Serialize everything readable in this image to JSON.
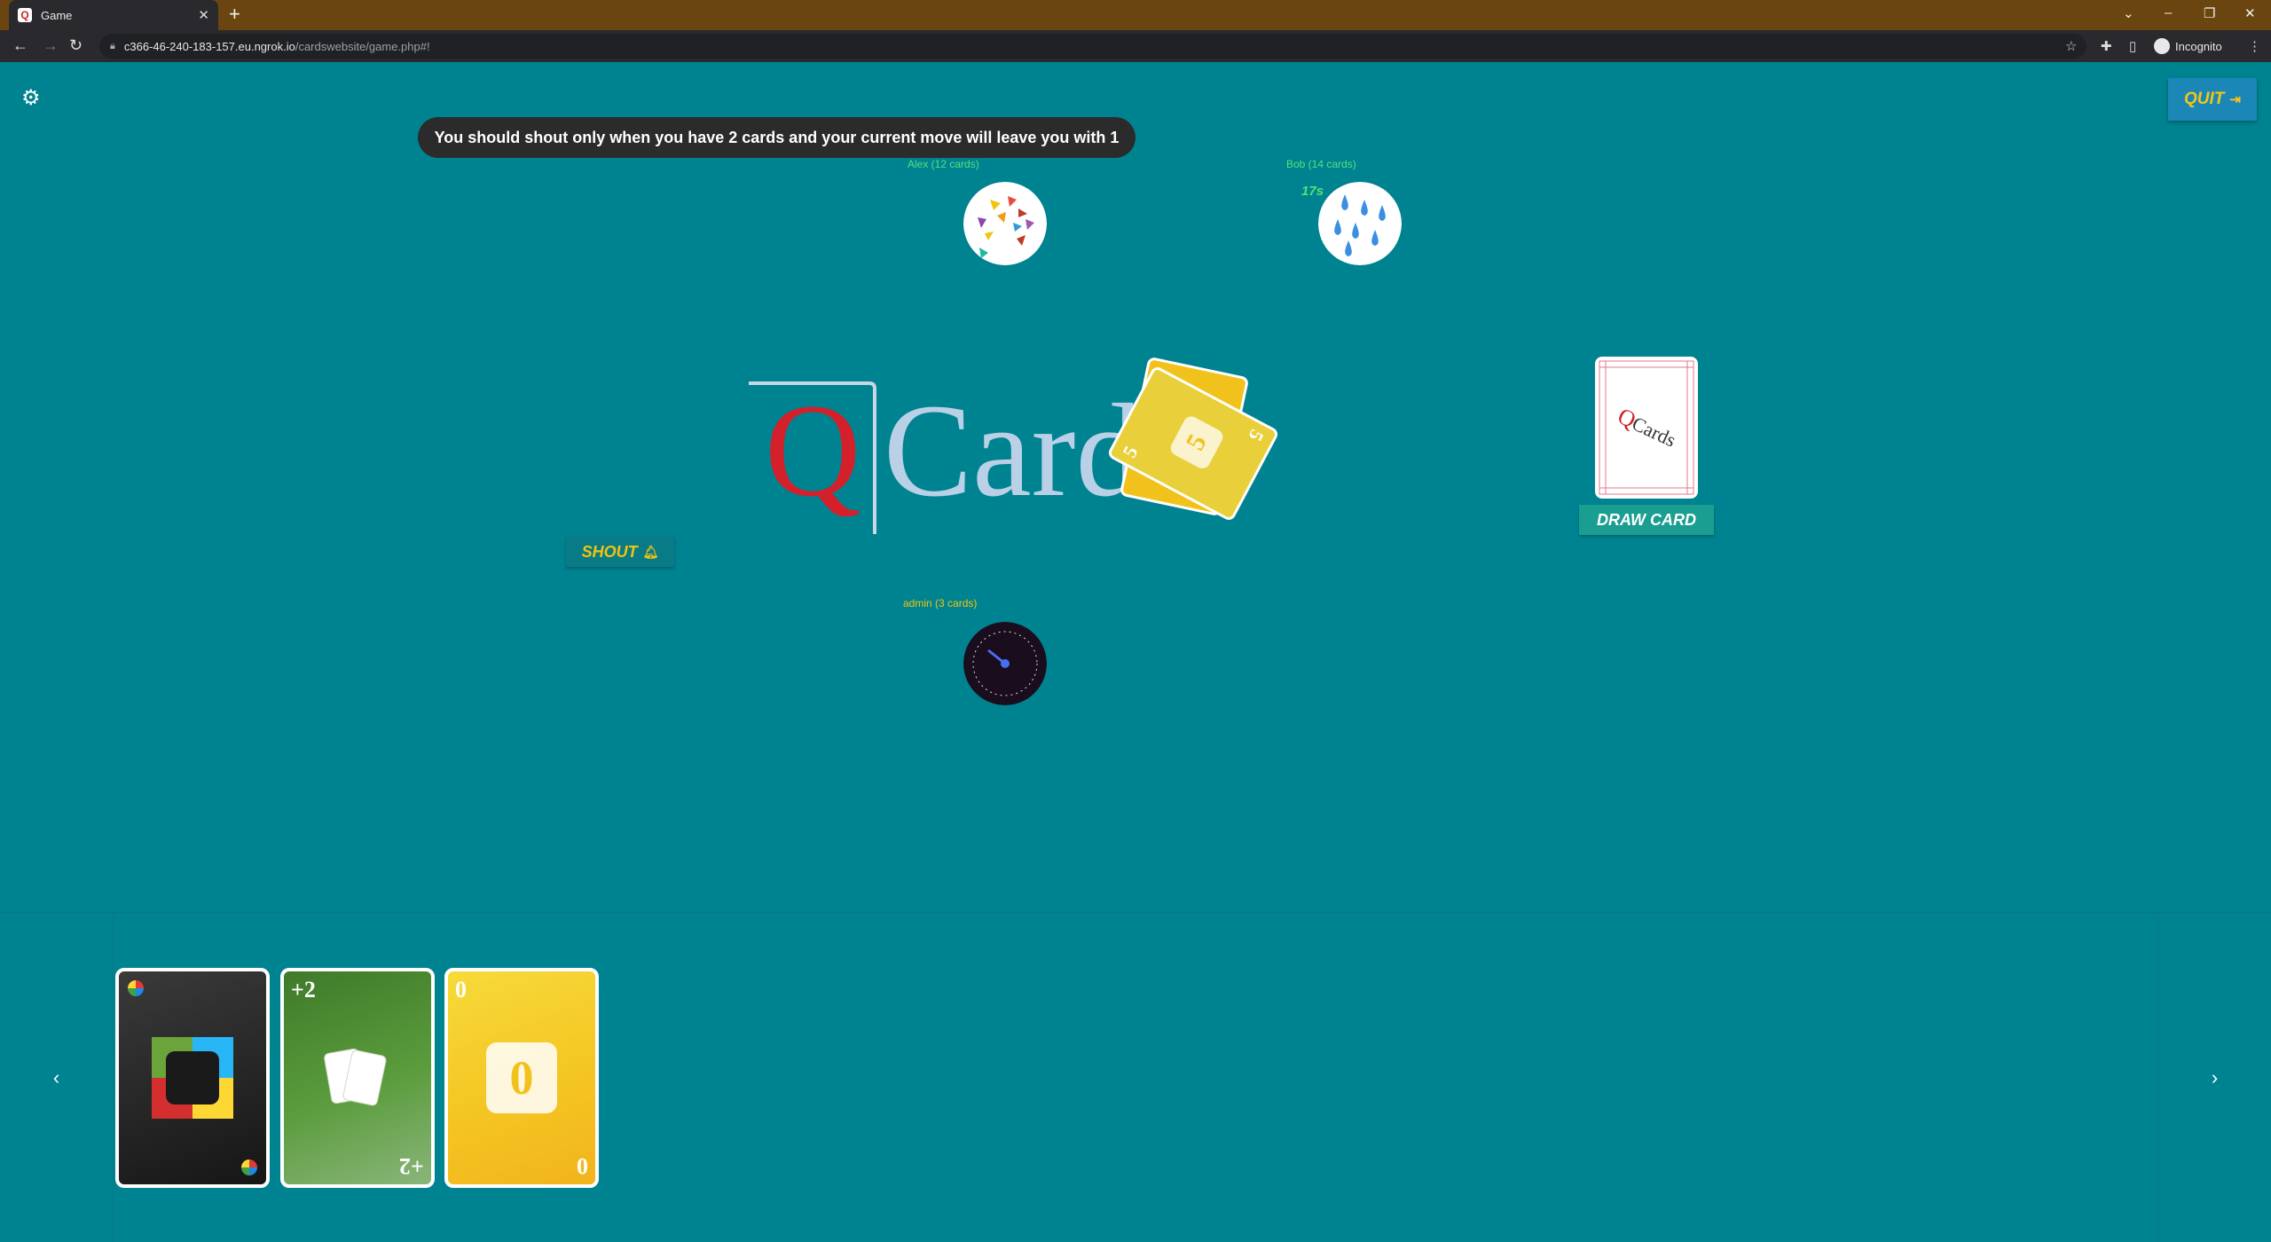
{
  "browser": {
    "tab_title": "Game",
    "tab_favicon_letter": "Q",
    "url_host": "c366-46-240-183-157.eu.ngrok.io",
    "url_path": "/cardswebsite/game.php#!",
    "incognito_label": "Incognito"
  },
  "header": {
    "settings_icon": "gear-icon",
    "quit_label": "QUIT"
  },
  "tooltip": "You should shout only when you have 2 cards and your current move will leave you with 1",
  "players": {
    "alex": {
      "label": "Alex (12 cards)"
    },
    "bob": {
      "label": "Bob (14 cards)",
      "timer": "17s"
    },
    "admin": {
      "label": "admin (3 cards)"
    }
  },
  "logo": {
    "q": "Q",
    "rest": "Cards",
    "draw_pile_text": "Cards"
  },
  "discard_top": {
    "value": "5",
    "color": "#f2c21c"
  },
  "buttons": {
    "draw_card": "DRAW CARD",
    "shout": "SHOUT"
  },
  "hand": {
    "cards": [
      {
        "type": "wild",
        "color": "#1e1e1e"
      },
      {
        "type": "draw",
        "label": "+2",
        "color": "#4f8c36"
      },
      {
        "type": "number",
        "label": "0",
        "color": "#f3c323"
      }
    ],
    "prev_icon": "chevron-left-icon",
    "next_icon": "chevron-right-icon"
  },
  "colors": {
    "table": "#008390",
    "accent_yellow": "#f1c40f",
    "player_green": "#55e07a"
  }
}
